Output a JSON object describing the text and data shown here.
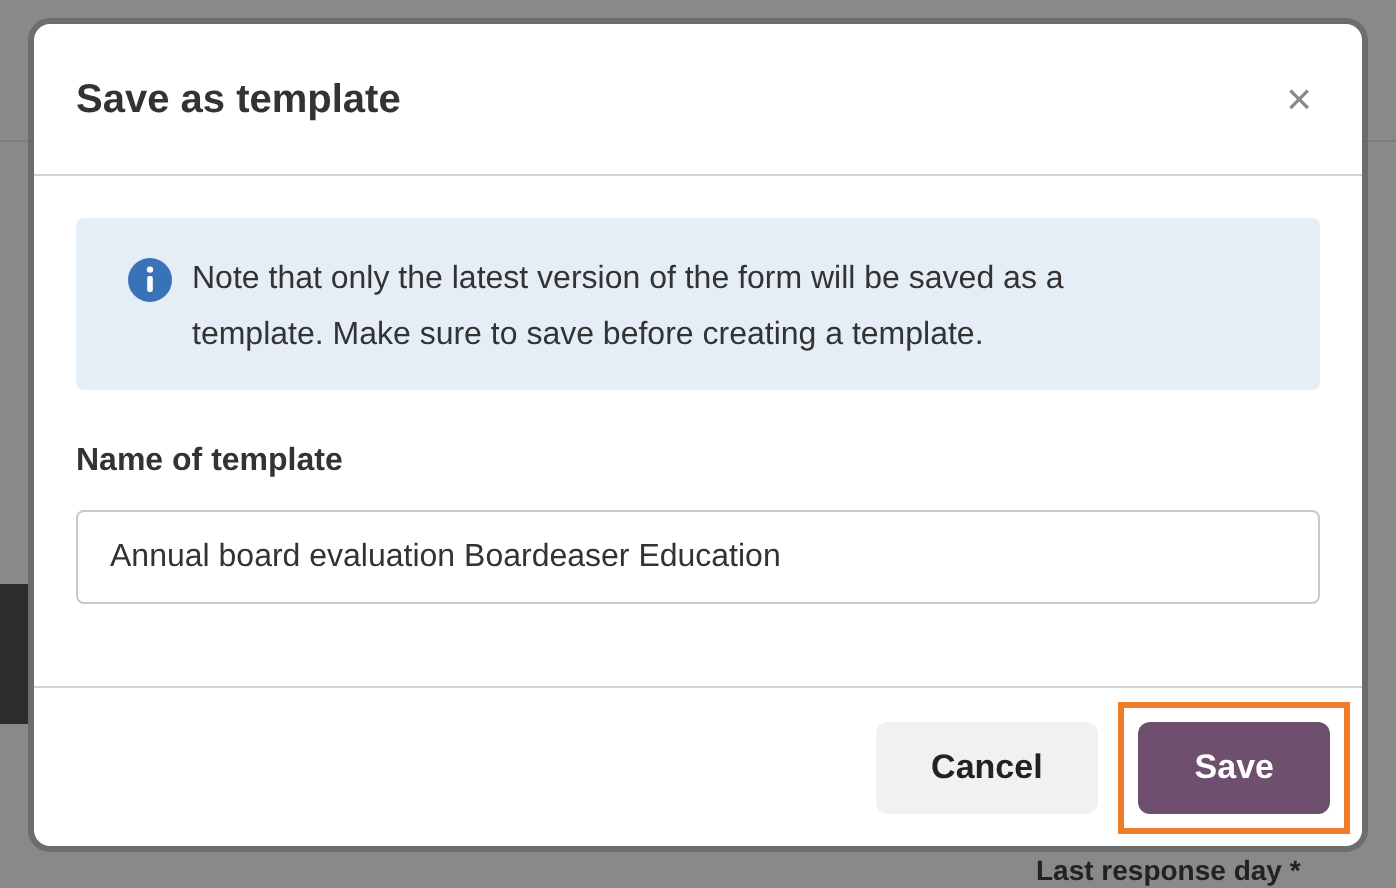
{
  "background": {
    "label": "Last response day *"
  },
  "dialog": {
    "title": "Save as template",
    "close": "×",
    "note": "Note that only the latest version of the form will be saved as a template. Make sure to save before creating a template.",
    "field": {
      "label": "Name of template",
      "value": "Annual board evaluation Boardeaser Education"
    },
    "buttons": [
      {
        "label": "Cancel",
        "kind": "secondary",
        "highlighted": false
      },
      {
        "label": "Save",
        "kind": "primary",
        "highlighted": true
      }
    ]
  }
}
